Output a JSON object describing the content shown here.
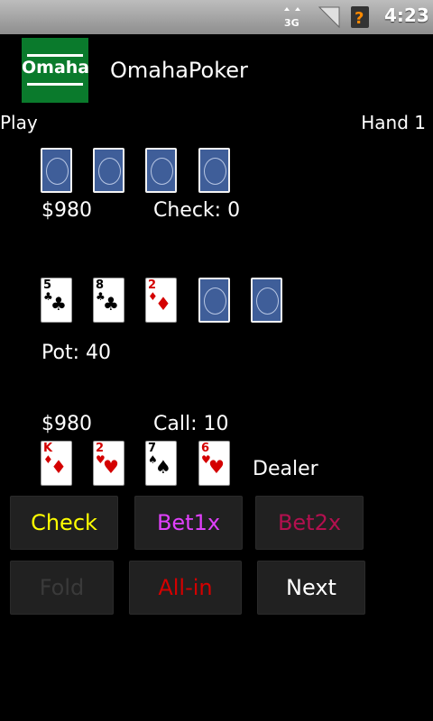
{
  "status_bar": {
    "time": "4:23",
    "icons": [
      "network-3g-icon",
      "signal-icon",
      "notification-icon"
    ]
  },
  "app": {
    "title": "OmahaPoker",
    "logo_text": "Omaha"
  },
  "header": {
    "mode": "Play",
    "hand": "Hand 1"
  },
  "opponent": {
    "cards": [
      "back",
      "back",
      "back",
      "back"
    ],
    "stack": "$980",
    "action": "Check: 0"
  },
  "board": {
    "cards": [
      {
        "rank": "5",
        "suit": "♣",
        "color": "black"
      },
      {
        "rank": "8",
        "suit": "♣",
        "color": "black"
      },
      {
        "rank": "2",
        "suit": "♦",
        "color": "red"
      },
      {
        "rank": "",
        "suit": "",
        "color": "back"
      },
      {
        "rank": "",
        "suit": "",
        "color": "back"
      }
    ],
    "pot": "Pot: 40"
  },
  "player": {
    "stack": "$980",
    "action": "Call: 10",
    "cards": [
      {
        "rank": "K",
        "suit": "♦",
        "color": "red"
      },
      {
        "rank": "2",
        "suit": "♥",
        "color": "red"
      },
      {
        "rank": "7",
        "suit": "♠",
        "color": "black"
      },
      {
        "rank": "6",
        "suit": "♥",
        "color": "red"
      }
    ],
    "role": "Dealer"
  },
  "buttons": {
    "check": {
      "label": "Check",
      "color": "#ffff00"
    },
    "bet1x": {
      "label": "Bet1x",
      "color": "#e040fb"
    },
    "bet2x": {
      "label": "Bet2x",
      "color": "#b3104f"
    },
    "fold": {
      "label": "Fold",
      "color": "#3a3a3a"
    },
    "allin": {
      "label": "All-in",
      "color": "#d40000"
    },
    "next": {
      "label": "Next",
      "color": "#ffffff"
    }
  }
}
